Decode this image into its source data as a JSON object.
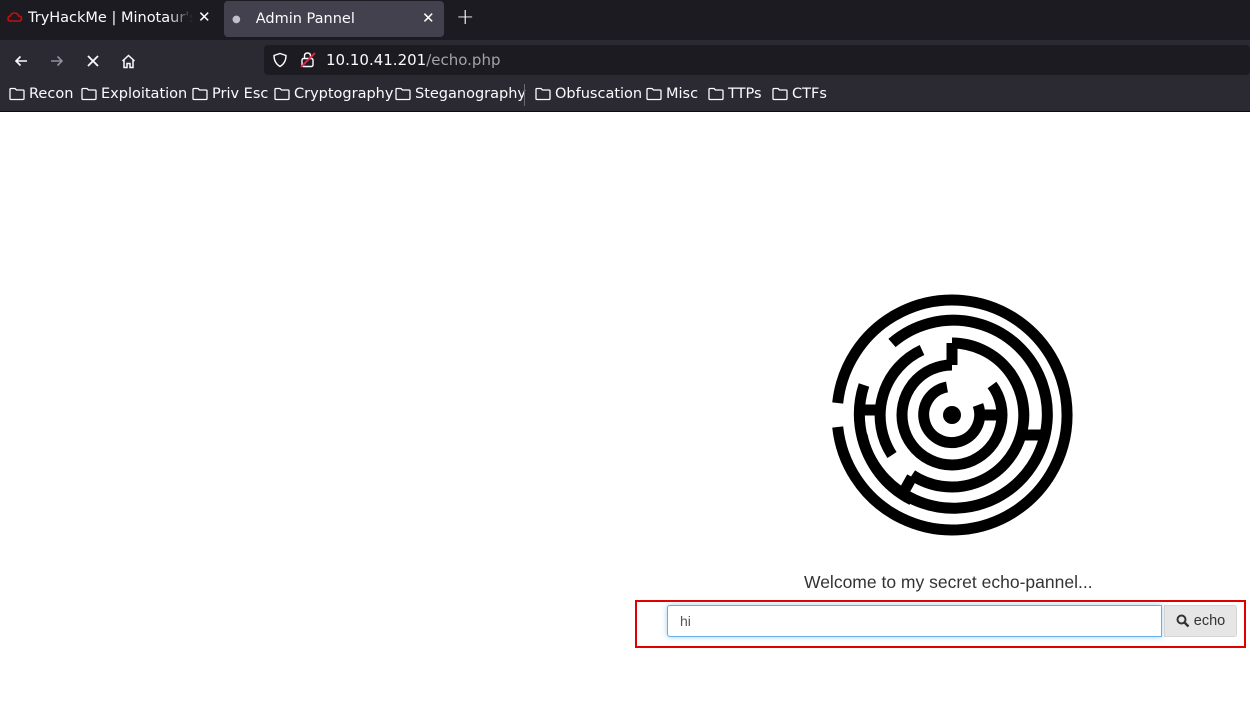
{
  "browser": {
    "tabs": [
      {
        "title": "TryHackMe | Minotaur's Labyrinth",
        "active": false
      },
      {
        "title": "Admin Pannel",
        "active": true
      }
    ],
    "url": {
      "host": "10.10.41.201",
      "path": "/echo.php"
    },
    "bookmarks": [
      "Recon",
      "Exploitation",
      "Priv Esc",
      "Cryptography",
      "Steganography",
      "Obfuscation",
      "Misc",
      "TTPs",
      "CTFs"
    ]
  },
  "page": {
    "welcome": "Welcome to my secret echo-pannel...",
    "input_value": "hi",
    "button_label": "echo"
  },
  "colors": {
    "highlight": "#e00000",
    "chrome": "#2b2a33"
  }
}
